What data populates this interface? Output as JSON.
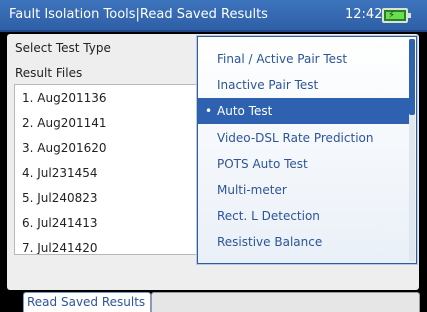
{
  "header": {
    "title": "Fault Isolation Tools|Read Saved Results",
    "time": "12:42",
    "battery_icon": "battery-charging-icon"
  },
  "form": {
    "test_type_label": "Select Test Type",
    "result_files_label": "Result Files"
  },
  "files": [
    "1. Aug201136",
    "2. Aug201141",
    "3. Aug201620",
    "4. Jul231454",
    "5. Jul240823",
    "6. Jul241413",
    "7. Jul241420"
  ],
  "menu": {
    "items": [
      "Final / Active Pair Test",
      "Inactive Pair Test",
      "Auto Test",
      "Video-DSL Rate Prediction",
      "POTS Auto Test",
      "Multi-meter",
      "Rect. L Detection",
      "Resistive Balance"
    ],
    "selected": "Auto Test",
    "selected_bullet": "•"
  },
  "tabs": {
    "active_label": "Read Saved Results"
  },
  "colors": {
    "titlebar": "#3d74bd",
    "selection": "#2e62b0",
    "menu_text": "#2c5597"
  }
}
